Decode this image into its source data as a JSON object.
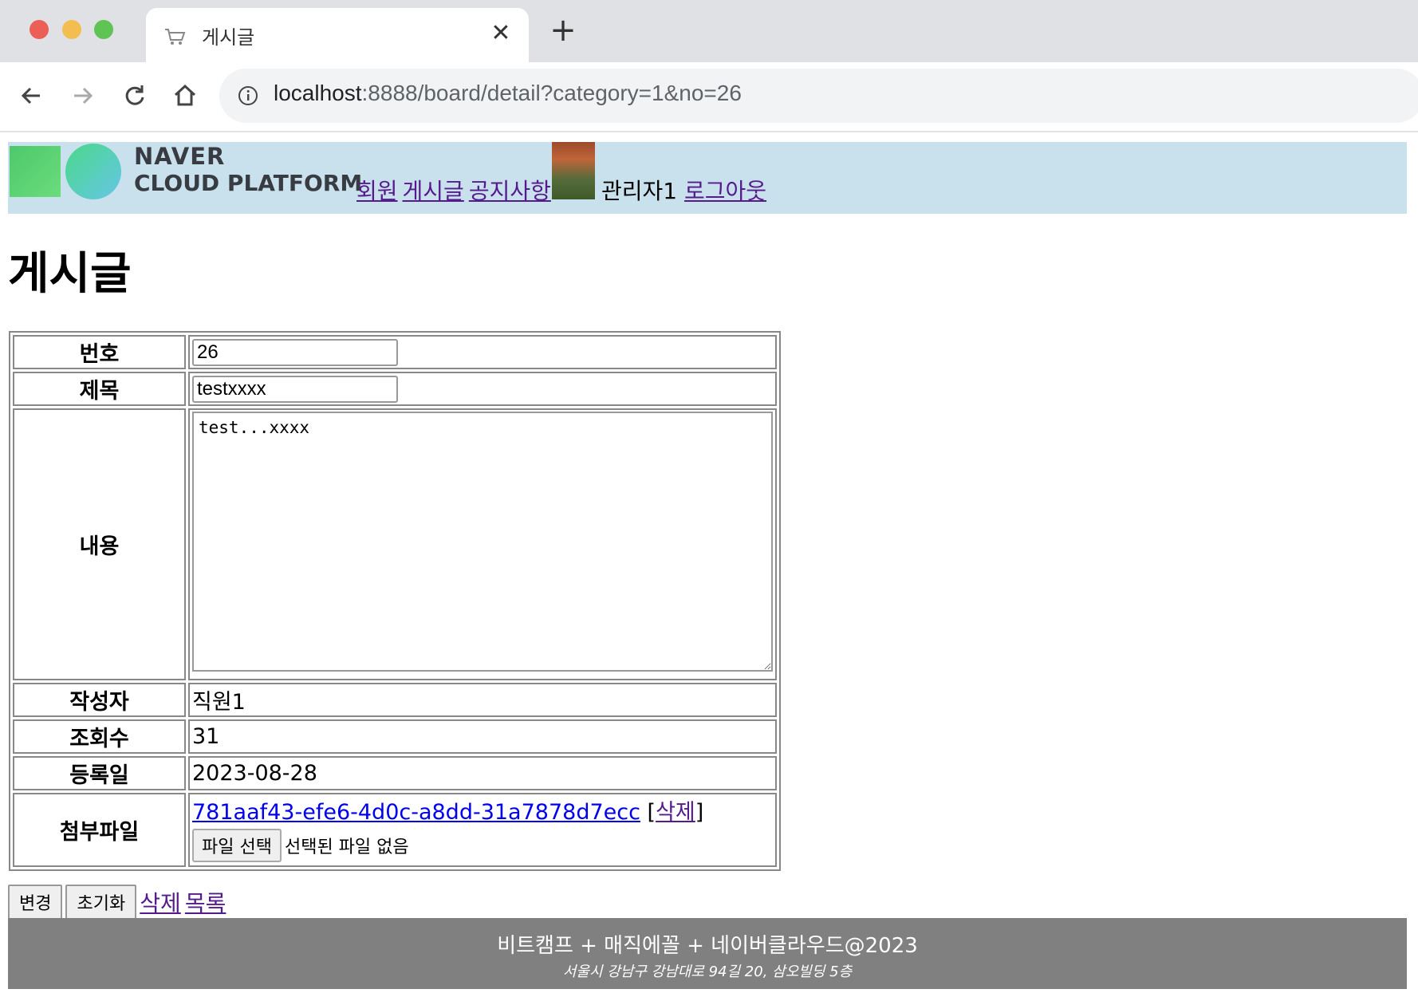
{
  "browser": {
    "tab_title": "게시글",
    "close_glyph": "✕",
    "newtab_glyph": "+",
    "url_host": "localhost",
    "url_path": ":8888/board/detail?category=1&no=26"
  },
  "header": {
    "logo_line1": "NAVER",
    "logo_line2": "CLOUD PLATFORM",
    "nav": [
      "회원",
      "게시글",
      "공지사항"
    ],
    "user_name": "관리자1",
    "logout": "로그아웃"
  },
  "page_title": "게시글",
  "form": {
    "labels": {
      "no": "번호",
      "title": "제목",
      "content": "내용",
      "writer": "작성자",
      "views": "조회수",
      "created": "등록일",
      "attach": "첨부파일"
    },
    "no": "26",
    "title": "testxxxx",
    "content": "test...xxxx",
    "writer": "직원1",
    "views": "31",
    "created": "2023-08-28",
    "attachment": {
      "filename": "781aaf43-efe6-4d0c-a8dd-31a7878d7ecc",
      "bracket_open": "[",
      "delete": "삭제",
      "bracket_close": "]"
    },
    "file_button": "파일 선택",
    "file_none": "선택된 파일 없음"
  },
  "actions": {
    "change": "변경",
    "reset": "초기화",
    "delete": "삭제",
    "list": "목록"
  },
  "footer": {
    "line1": "비트캠프 + 매직에꼴 + 네이버클라우드@2023",
    "line2": "서울시 강남구 강남대로 94길 20, 삼오빌딩 5층"
  }
}
